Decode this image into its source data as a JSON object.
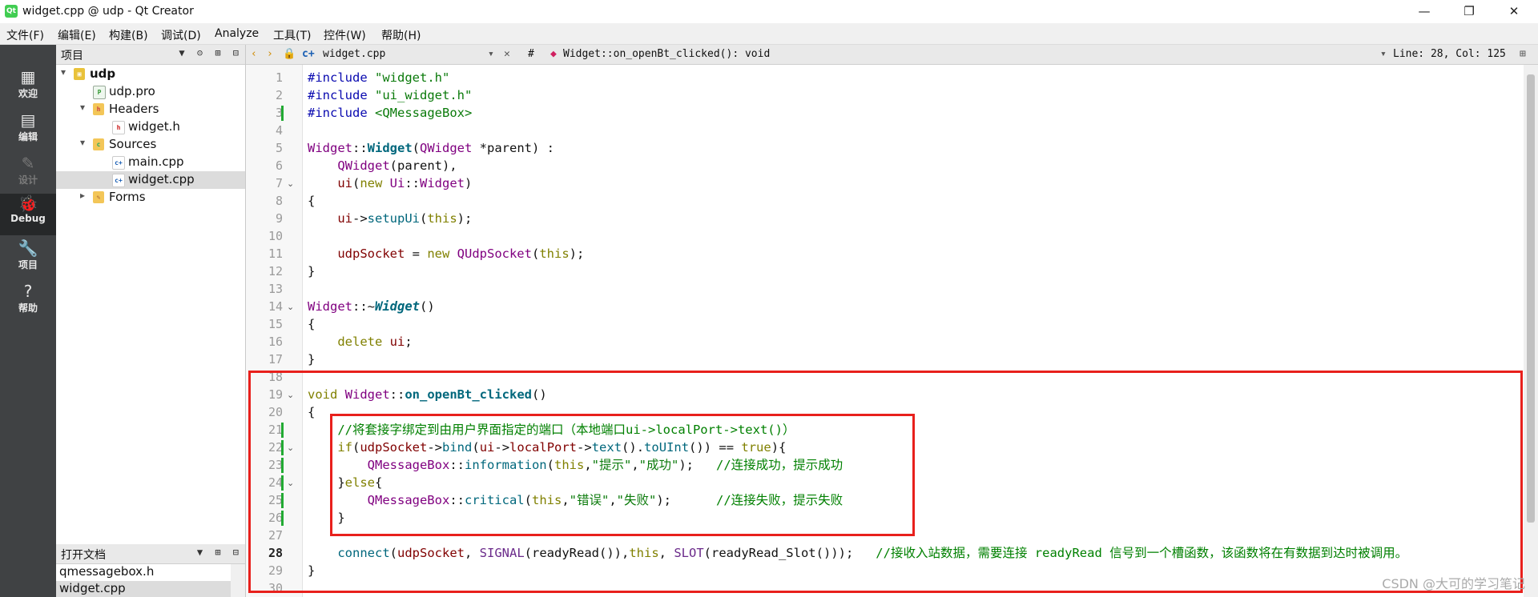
{
  "window": {
    "title": "widget.cpp @ udp - Qt Creator",
    "app_icon": "qt-logo",
    "controls": [
      "—",
      "❐",
      "✕"
    ]
  },
  "menubar": [
    "文件(F)",
    "编辑(E)",
    "构建(B)",
    "调试(D)",
    "Analyze",
    "工具(T)",
    "控件(W)",
    "帮助(H)"
  ],
  "modes": [
    {
      "label": "欢迎",
      "icon": "grid-icon",
      "glyph": "▦"
    },
    {
      "label": "编辑",
      "icon": "document-icon",
      "glyph": "▤"
    },
    {
      "label": "设计",
      "icon": "pencil-icon",
      "glyph": "✎"
    },
    {
      "label": "Debug",
      "icon": "bug-icon",
      "glyph": "🐞"
    },
    {
      "label": "项目",
      "icon": "wrench-icon",
      "glyph": "🔧"
    },
    {
      "label": "帮助",
      "icon": "help-icon",
      "glyph": "?"
    }
  ],
  "projects_pane": {
    "title": "项目",
    "tree": [
      {
        "label": "udp",
        "type": "project",
        "bold": true
      },
      {
        "label": "udp.pro",
        "type": "pro-file"
      },
      {
        "label": "Headers",
        "type": "folder"
      },
      {
        "label": "widget.h",
        "type": "header-file"
      },
      {
        "label": "Sources",
        "type": "folder"
      },
      {
        "label": "main.cpp",
        "type": "cpp-file"
      },
      {
        "label": "widget.cpp",
        "type": "cpp-file",
        "selected": true
      },
      {
        "label": "Forms",
        "type": "folder"
      }
    ]
  },
  "open_docs": {
    "title": "打开文档",
    "items": [
      "qmessagebox.h",
      "widget.cpp"
    ]
  },
  "editor_toolbar": {
    "file": "widget.cpp",
    "hash": "#",
    "symbol": "Widget::on_openBt_clicked(): void",
    "position": "Line: 28, Col: 125"
  },
  "editor": {
    "current_line": 28,
    "lines": [
      {
        "n": 1,
        "t": [
          [
            "#include ",
            "pp"
          ],
          [
            "\"widget.h\"",
            "str"
          ]
        ]
      },
      {
        "n": 2,
        "t": [
          [
            "#include ",
            "pp"
          ],
          [
            "\"ui_widget.h\"",
            "str"
          ]
        ]
      },
      {
        "n": 3,
        "t": [
          [
            "#include ",
            "pp"
          ],
          [
            "<QMessageBox>",
            "str"
          ]
        ]
      },
      {
        "n": 4,
        "t": []
      },
      {
        "n": 5,
        "t": [
          [
            "Widget",
            "cls"
          ],
          [
            "::",
            ""
          ],
          [
            "Widget",
            "fnb"
          ],
          [
            "(",
            ""
          ],
          [
            "QWidget",
            "cls"
          ],
          [
            " *parent) :",
            ""
          ]
        ]
      },
      {
        "n": 6,
        "t": [
          [
            "    ",
            ""
          ],
          [
            "QWidget",
            "cls"
          ],
          [
            "(parent),",
            ""
          ]
        ]
      },
      {
        "n": 7,
        "t": [
          [
            "    ",
            ""
          ],
          [
            "ui",
            "mem"
          ],
          [
            "(",
            ""
          ],
          [
            "new ",
            "kw"
          ],
          [
            "Ui",
            "cls"
          ],
          [
            "::",
            ""
          ],
          [
            "Widget",
            "cls"
          ],
          [
            ")",
            ""
          ]
        ]
      },
      {
        "n": 8,
        "t": [
          [
            "{",
            ""
          ]
        ]
      },
      {
        "n": 9,
        "t": [
          [
            "    ",
            ""
          ],
          [
            "ui",
            "mem"
          ],
          [
            "->",
            ""
          ],
          [
            "setupUi",
            "fn"
          ],
          [
            "(",
            ""
          ],
          [
            "this",
            "kw"
          ],
          [
            ");",
            ""
          ]
        ]
      },
      {
        "n": 10,
        "t": []
      },
      {
        "n": 11,
        "t": [
          [
            "    ",
            ""
          ],
          [
            "udpSocket",
            "mem"
          ],
          [
            " = ",
            ""
          ],
          [
            "new ",
            "kw"
          ],
          [
            "QUdpSocket",
            "cls"
          ],
          [
            "(",
            ""
          ],
          [
            "this",
            "kw"
          ],
          [
            ");",
            ""
          ]
        ]
      },
      {
        "n": 12,
        "t": [
          [
            "}",
            ""
          ]
        ]
      },
      {
        "n": 13,
        "t": []
      },
      {
        "n": 14,
        "t": [
          [
            "Widget",
            "cls"
          ],
          [
            "::~",
            ""
          ],
          [
            "Widget",
            "fni"
          ],
          [
            "()",
            ""
          ]
        ]
      },
      {
        "n": 15,
        "t": [
          [
            "{",
            ""
          ]
        ]
      },
      {
        "n": 16,
        "t": [
          [
            "    ",
            ""
          ],
          [
            "delete ",
            "kw"
          ],
          [
            "ui",
            "mem"
          ],
          [
            ";",
            ""
          ]
        ]
      },
      {
        "n": 17,
        "t": [
          [
            "}",
            ""
          ]
        ]
      },
      {
        "n": 18,
        "t": []
      },
      {
        "n": 19,
        "t": [
          [
            "void ",
            "kw"
          ],
          [
            "Widget",
            "cls"
          ],
          [
            "::",
            ""
          ],
          [
            "on_openBt_clicked",
            "fnb"
          ],
          [
            "()",
            ""
          ]
        ]
      },
      {
        "n": 20,
        "t": [
          [
            "{",
            ""
          ]
        ]
      },
      {
        "n": 21,
        "t": [
          [
            "    ",
            ""
          ],
          [
            "//将套接字绑定到由用户界面指定的端口（本地端口ui->localPort->text()）",
            "cmt"
          ]
        ]
      },
      {
        "n": 22,
        "t": [
          [
            "    ",
            ""
          ],
          [
            "if",
            "kw"
          ],
          [
            "(",
            ""
          ],
          [
            "udpSocket",
            "mem"
          ],
          [
            "->",
            ""
          ],
          [
            "bind",
            "fn"
          ],
          [
            "(",
            ""
          ],
          [
            "ui",
            "mem"
          ],
          [
            "->",
            ""
          ],
          [
            "localPort",
            "mem"
          ],
          [
            "->",
            ""
          ],
          [
            "text",
            "fn"
          ],
          [
            "().",
            ""
          ],
          [
            "toUInt",
            "fn"
          ],
          [
            "()) == ",
            ""
          ],
          [
            "true",
            "kw"
          ],
          [
            "){",
            ""
          ]
        ]
      },
      {
        "n": 23,
        "t": [
          [
            "        ",
            ""
          ],
          [
            "QMessageBox",
            "cls"
          ],
          [
            "::",
            ""
          ],
          [
            "information",
            "fn"
          ],
          [
            "(",
            ""
          ],
          [
            "this",
            "kw"
          ],
          [
            ",",
            ""
          ],
          [
            "\"提示\"",
            "str"
          ],
          [
            ",",
            ""
          ],
          [
            "\"成功\"",
            "str"
          ],
          [
            ");   ",
            ""
          ],
          [
            "//连接成功，提示成功",
            "cmt"
          ]
        ]
      },
      {
        "n": 24,
        "t": [
          [
            "    ",
            ""
          ],
          [
            "}",
            ""
          ],
          [
            "else",
            "kw"
          ],
          [
            "{",
            ""
          ]
        ]
      },
      {
        "n": 25,
        "t": [
          [
            "        ",
            ""
          ],
          [
            "QMessageBox",
            "cls"
          ],
          [
            "::",
            ""
          ],
          [
            "critical",
            "fn"
          ],
          [
            "(",
            ""
          ],
          [
            "this",
            "kw"
          ],
          [
            ",",
            ""
          ],
          [
            "\"错误\"",
            "str"
          ],
          [
            ",",
            ""
          ],
          [
            "\"失败\"",
            "str"
          ],
          [
            ");      ",
            ""
          ],
          [
            "//连接失败，提示失败",
            "cmt"
          ]
        ]
      },
      {
        "n": 26,
        "t": [
          [
            "    ",
            ""
          ],
          [
            "}",
            ""
          ]
        ]
      },
      {
        "n": 27,
        "t": []
      },
      {
        "n": 28,
        "t": [
          [
            "    ",
            ""
          ],
          [
            "connect",
            "fn"
          ],
          [
            "(",
            ""
          ],
          [
            "udpSocket",
            "mem"
          ],
          [
            ", ",
            ""
          ],
          [
            "SIGNAL",
            "mac"
          ],
          [
            "(readyRead()),",
            ""
          ],
          [
            "this",
            "kw"
          ],
          [
            ", ",
            ""
          ],
          [
            "SLOT",
            "mac"
          ],
          [
            "(readyRead_Slot()));   ",
            ""
          ],
          [
            "//接收入站数据，需要连接 readyRead 信号到一个槽函数，该函数将在有数据到达时被调用。",
            "cmt"
          ]
        ]
      },
      {
        "n": 29,
        "t": [
          [
            "}",
            ""
          ]
        ]
      },
      {
        "n": 30,
        "t": []
      }
    ],
    "fold_lines": [
      7,
      14,
      19,
      22,
      24
    ],
    "change_marks": [
      3,
      21,
      22,
      23,
      24,
      25,
      26
    ]
  },
  "watermark": "CSDN @大可的学习笔记",
  "colors": {
    "highlight_box": "#e8201c",
    "modebar": "#404244"
  }
}
